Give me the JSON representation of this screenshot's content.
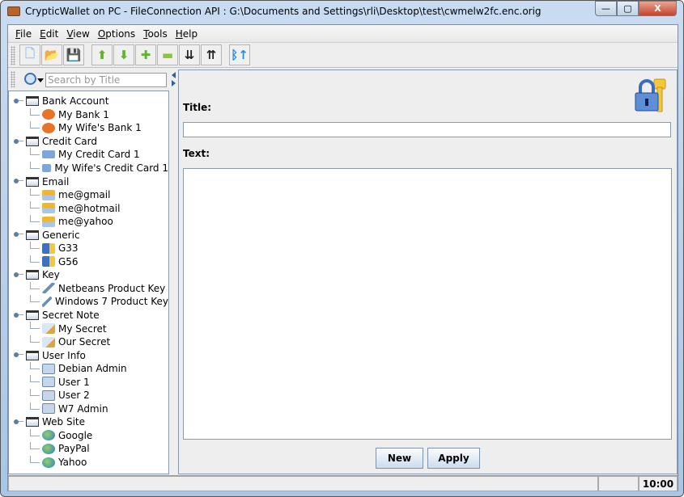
{
  "window": {
    "title": "CrypticWallet on PC - FileConnection API : G:\\Documents and Settings\\rli\\Desktop\\test\\cwmelw2fc.enc.orig",
    "minimize": "—",
    "maximize": "▢",
    "close": "X"
  },
  "menu": [
    {
      "key": "F",
      "rest": "ile"
    },
    {
      "key": "E",
      "rest": "dit"
    },
    {
      "key": "V",
      "rest": "iew"
    },
    {
      "key": "O",
      "rest": "ptions"
    },
    {
      "key": "T",
      "rest": "ools"
    },
    {
      "key": "H",
      "rest": "elp"
    }
  ],
  "toolbar": [
    {
      "name": "new-file",
      "glyph": "🗋",
      "color": "#9cc3ea"
    },
    {
      "name": "open-folder",
      "glyph": "📂",
      "color": "#3b7fc9"
    },
    {
      "name": "save",
      "glyph": "💾",
      "color": "#333"
    },
    {
      "name": "move-up",
      "glyph": "⬆",
      "color": "#5fb62c"
    },
    {
      "name": "move-down",
      "glyph": "⬇",
      "color": "#5fb62c"
    },
    {
      "name": "add",
      "glyph": "✚",
      "color": "#5fb62c"
    },
    {
      "name": "remove",
      "glyph": "▬",
      "color": "#8bc63a"
    },
    {
      "name": "sort-descending",
      "glyph": "⇊",
      "color": "#222"
    },
    {
      "name": "sort-ascending",
      "glyph": "⇈",
      "color": "#222"
    },
    {
      "name": "bluetooth-send",
      "glyph": "ᛒ↑",
      "color": "#2a8ad8"
    }
  ],
  "search": {
    "placeholder": "Search by Title"
  },
  "tree": [
    {
      "label": "Bank Account",
      "icon": "bank",
      "items": [
        "My Bank 1",
        "My Wife's Bank 1"
      ]
    },
    {
      "label": "Credit Card",
      "icon": "card",
      "items": [
        "My Credit Card 1",
        "My Wife's  Credit Card 1"
      ]
    },
    {
      "label": "Email",
      "icon": "mail",
      "items": [
        "me@gmail",
        "me@hotmail",
        "me@yahoo"
      ]
    },
    {
      "label": "Generic",
      "icon": "generic",
      "items": [
        "G33",
        "G56"
      ]
    },
    {
      "label": "Key",
      "icon": "key",
      "items": [
        "Netbeans Product Key",
        "Windows 7 Product Key"
      ]
    },
    {
      "label": "Secret Note",
      "icon": "note",
      "items": [
        "My Secret",
        "Our Secret"
      ]
    },
    {
      "label": "User Info",
      "icon": "user",
      "items": [
        "Debian Admin",
        "User 1",
        "User 2",
        "W7 Admin"
      ]
    },
    {
      "label": "Web Site",
      "icon": "web",
      "items": [
        "Google",
        "PayPal",
        "Yahoo"
      ]
    }
  ],
  "editor": {
    "title_label": "Title:",
    "title_value": "",
    "text_label": "Text:",
    "text_value": "",
    "new_button": "New",
    "apply_button": "Apply"
  },
  "status": {
    "message": "",
    "middle": "",
    "time": "10:00"
  }
}
